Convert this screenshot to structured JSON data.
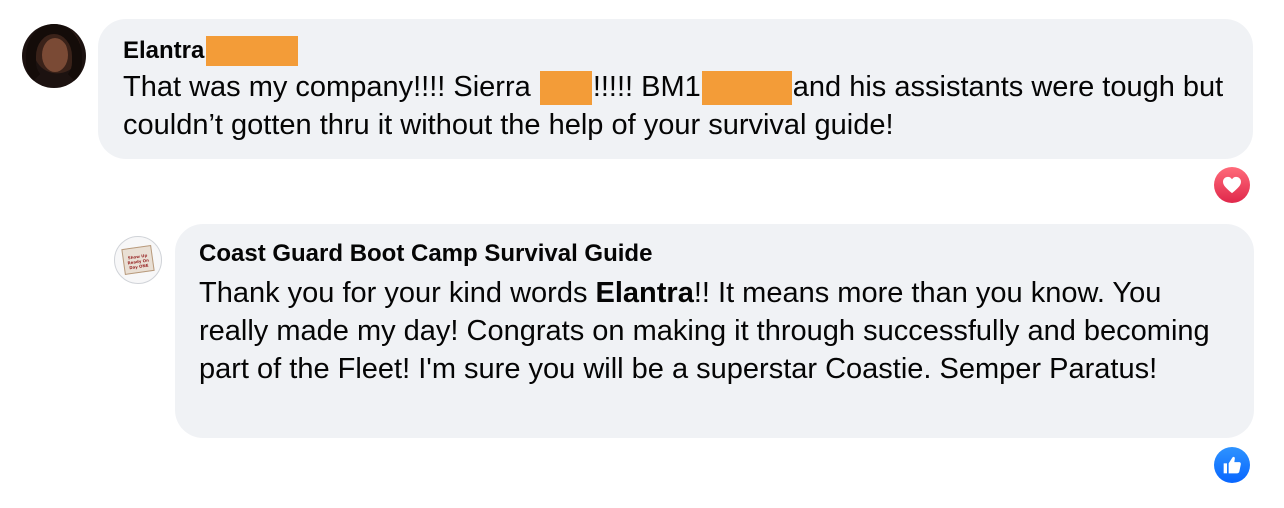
{
  "comment": {
    "author": "Elantra",
    "text_part1": "That was my company!!!! Sierra ",
    "text_part2": "!!!!! BM1",
    "text_part3": "and his assistants were tough but couldn’t gotten thru it without the help of your survival guide!",
    "reaction_icon": "heart-icon",
    "reaction_color": "#e0284b"
  },
  "reply": {
    "author": "Coast Guard Boot Camp Survival Guide",
    "avatar_text": "Show Up Ready On Day ONE",
    "text_part1": "Thank you for your kind words ",
    "text_bold": "Elantra",
    "text_part2": "!! It means more than you know. You really made my day! Congrats on making it through successfully and becoming part of the Fleet! I'm sure you will be a superstar Coastie. Semper Paratus!",
    "reaction_icon": "thumbs-up-icon",
    "reaction_color": "#0866ff"
  },
  "colors": {
    "bubble": "#f0f2f5",
    "redaction": "#f39c38",
    "text": "#050505"
  }
}
